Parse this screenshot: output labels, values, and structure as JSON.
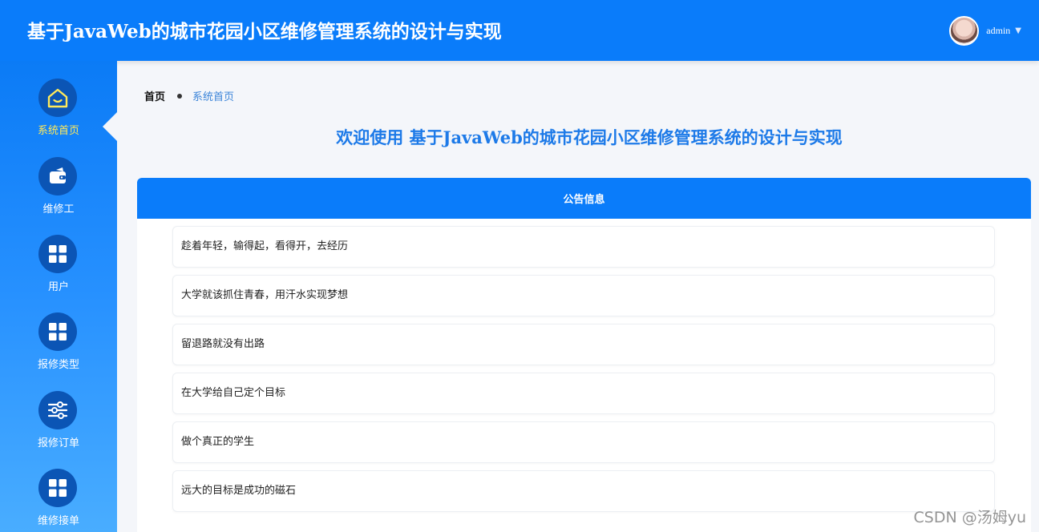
{
  "header": {
    "title": "基于JavaWeb的城市花园小区维修管理系统的设计与实现",
    "username": "admin",
    "caret": "▼"
  },
  "sidebar": {
    "items": [
      {
        "label": "系统首页",
        "icon": "home-icon",
        "active": true
      },
      {
        "label": "维修工",
        "icon": "wallet-icon"
      },
      {
        "label": "用户",
        "icon": "grid-icon"
      },
      {
        "label": "报修类型",
        "icon": "grid-icon"
      },
      {
        "label": "报修订单",
        "icon": "sliders-icon"
      },
      {
        "label": "维修接单",
        "icon": "grid-icon"
      }
    ]
  },
  "breadcrumb": {
    "home": "首页",
    "current": "系统首页"
  },
  "welcome": "欢迎使用 基于JavaWeb的城市花园小区维修管理系统的设计与实现",
  "notice_panel": {
    "title": "公告信息",
    "items": [
      "趁着年轻，输得起，看得开，去经历",
      "大学就该抓住青春，用汗水实现梦想",
      "留退路就没有出路",
      "在大学给自己定个目标",
      "做个真正的学生",
      "远大的目标是成功的磁石"
    ]
  },
  "watermark": "CSDN @汤姆yu",
  "colors": {
    "primary": "#0a7cfa",
    "active_label": "#ffe95a",
    "welcome_text": "#1d7ae8",
    "icon_circle": "#0b55b5"
  }
}
